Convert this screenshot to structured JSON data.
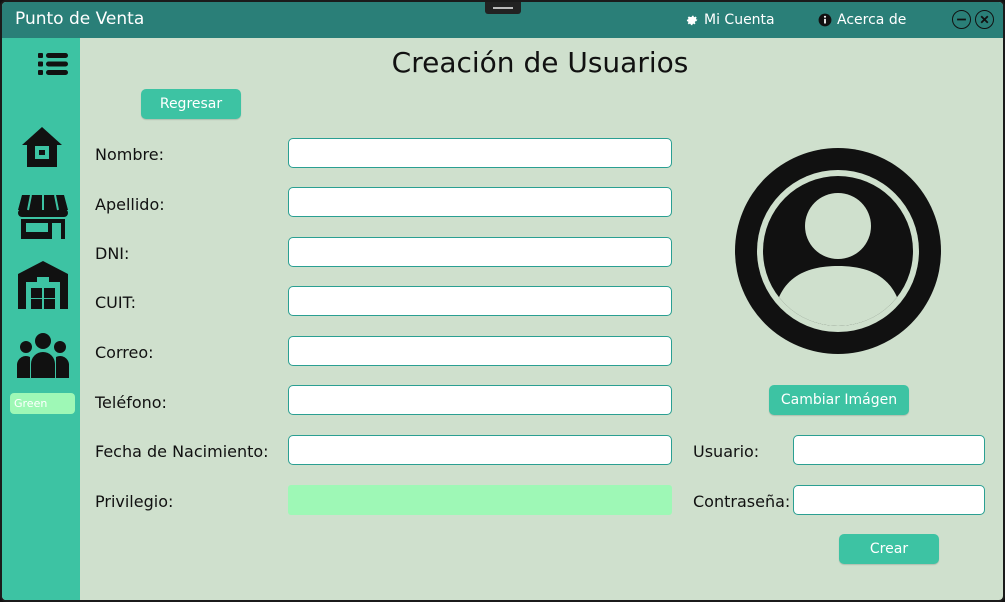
{
  "titlebar": {
    "app_title": "Punto de Venta",
    "account_label": "Mi Cuenta",
    "about_label": "Acerca de"
  },
  "sidebar": {
    "items": [
      {
        "name": "menu-icon"
      },
      {
        "name": "home-icon"
      },
      {
        "name": "store-icon"
      },
      {
        "name": "warehouse-icon"
      },
      {
        "name": "users-icon"
      }
    ],
    "theme_label": "Green"
  },
  "main": {
    "title": "Creación de Usuarios",
    "back_button": "Regresar",
    "fields": [
      {
        "label": "Nombre:",
        "value": ""
      },
      {
        "label": "Apellido:",
        "value": ""
      },
      {
        "label": "DNI:",
        "value": ""
      },
      {
        "label": "CUIT:",
        "value": ""
      },
      {
        "label": "Correo:",
        "value": ""
      },
      {
        "label": "Teléfono:",
        "value": ""
      },
      {
        "label": "Fecha de Nacimiento:",
        "value": ""
      },
      {
        "label": "Privilegio:",
        "value": ""
      }
    ],
    "change_image_button": "Cambiar Imágen",
    "username_label": "Usuario:",
    "username_value": "",
    "password_label": "Contraseña:",
    "password_value": "",
    "create_button": "Crear"
  },
  "colors": {
    "titlebar": "#2a7f78",
    "sidebar": "#3dc3a3",
    "background": "#cfe0cd",
    "accent_select": "#9ef8b6",
    "input_border": "#2a9f92"
  }
}
